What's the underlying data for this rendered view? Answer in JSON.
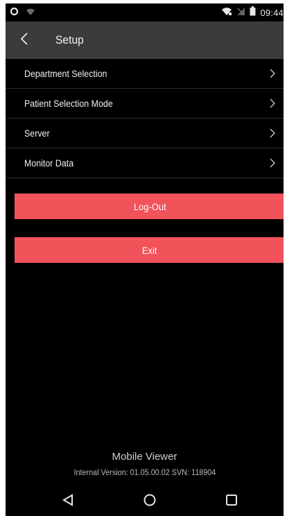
{
  "status_bar": {
    "time": "09:44",
    "icons": [
      "circle-status-icon",
      "wifi-icon",
      "wifi-signal-icon",
      "signal-off-icon",
      "battery-icon"
    ]
  },
  "app_bar": {
    "title": "Setup",
    "back_icon": "chevron-left-icon"
  },
  "menu": {
    "items": [
      {
        "label": "Department Selection"
      },
      {
        "label": "Patient Selection Mode"
      },
      {
        "label": "Server"
      },
      {
        "label": "Monitor Data"
      }
    ]
  },
  "buttons": {
    "logout_label": "Log-Out",
    "exit_label": "Exit"
  },
  "footer": {
    "app_name": "Mobile Viewer",
    "version": "Internal Version: 01.05.00.02 SVN: 118904"
  },
  "nav_bar": {
    "icons": [
      "back-triangle-icon",
      "home-circle-icon",
      "recent-square-icon"
    ]
  },
  "colors": {
    "background": "#000000",
    "app_bar": "#3b3b3b",
    "accent_button": "#f2525a"
  }
}
